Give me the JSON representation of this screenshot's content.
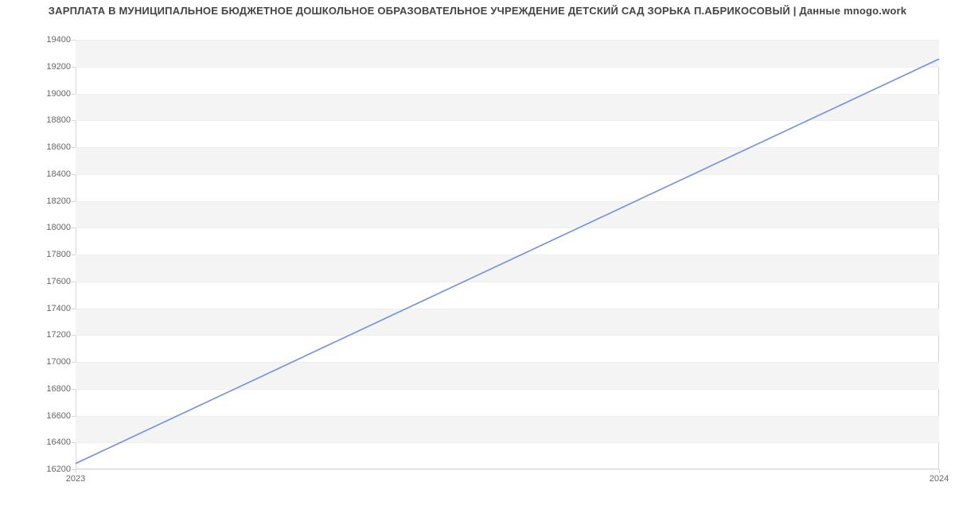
{
  "chart_data": {
    "type": "line",
    "title": "ЗАРПЛАТА В МУНИЦИПАЛЬНОЕ БЮДЖЕТНОЕ ДОШКОЛЬНОЕ ОБРАЗОВАТЕЛЬНОЕ УЧРЕЖДЕНИЕ ДЕТСКИЙ САД ЗОРЬКА П.АБРИКОСОВЫЙ | Данные mnogo.work",
    "x": [
      2023,
      2024
    ],
    "x_ticks": [
      2023,
      2024
    ],
    "series": [
      {
        "name": "Зарплата",
        "values": [
          16243,
          19257
        ],
        "color": "#6f8fe6"
      }
    ],
    "y_ticks": [
      16200,
      16400,
      16600,
      16800,
      17000,
      17200,
      17400,
      17600,
      17800,
      18000,
      18200,
      18400,
      18600,
      18800,
      19000,
      19200,
      19400
    ],
    "ylim": [
      16200,
      19400
    ],
    "xlabel": "",
    "ylabel": "",
    "grid": true,
    "legend": false
  }
}
